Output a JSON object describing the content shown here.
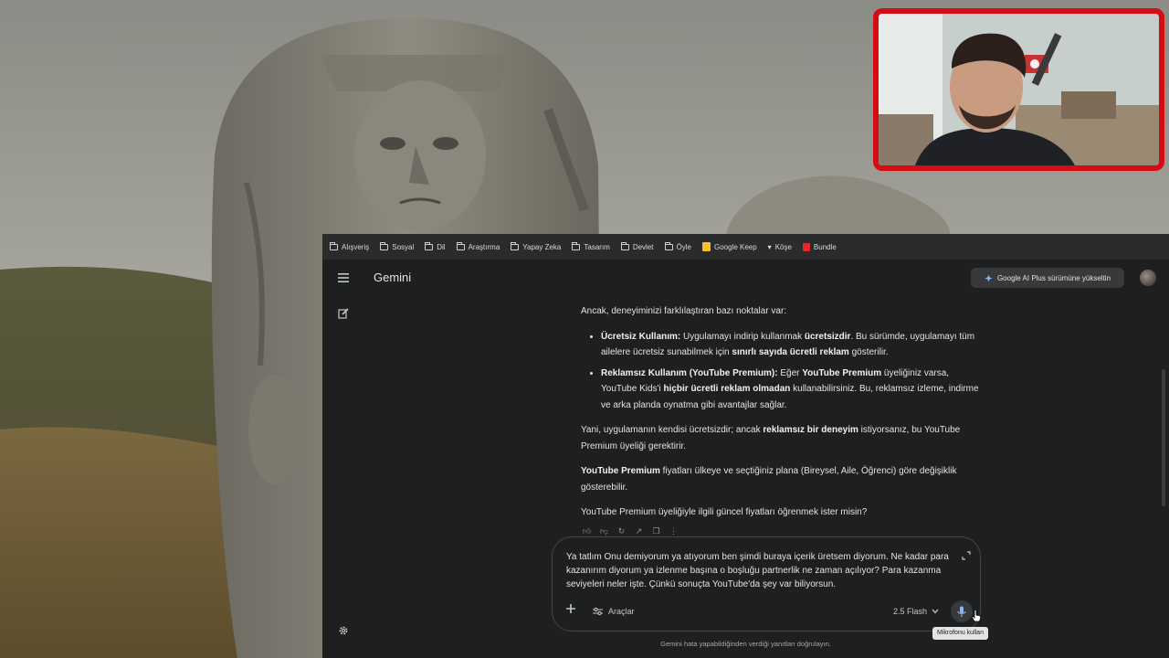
{
  "bookmarks": [
    {
      "label": "Alışveriş",
      "icon": "folder-icon"
    },
    {
      "label": "Sosyal",
      "icon": "folder-icon"
    },
    {
      "label": "Dil",
      "icon": "folder-icon"
    },
    {
      "label": "Araştırma",
      "icon": "folder-icon"
    },
    {
      "label": "Yapay Zeka",
      "icon": "folder-icon"
    },
    {
      "label": "Tasarım",
      "icon": "folder-icon"
    },
    {
      "label": "Devlet",
      "icon": "folder-icon"
    },
    {
      "label": "Öyle",
      "icon": "folder-icon"
    },
    {
      "label": "Google Keep",
      "icon": "keep-icon"
    },
    {
      "label": "Köşe",
      "icon": "kose-icon"
    },
    {
      "label": "Bundle",
      "icon": "bundle-icon"
    }
  ],
  "header": {
    "app_title": "Gemini",
    "upgrade_label": "Google AI Plus sürümüne yükseltin"
  },
  "chat": {
    "intro": "Ancak, deneyiminizi farklılaştıran bazı noktalar var:",
    "b1_title": "Ücretsiz Kullanım:",
    "b1_t1": " Uygulamayı indirip kullanmak ",
    "b1_bold1": "ücretsizdir",
    "b1_t2": ". Bu sürümde, uygulamayı tüm ailelere ücretsiz sunabilmek için ",
    "b1_bold2": "sınırlı sayıda ücretli reklam",
    "b1_t3": " gösterilir.",
    "b2_title": "Reklamsız Kullanım (YouTube Premium):",
    "b2_t1": " Eğer ",
    "b2_bold1": "YouTube Premium",
    "b2_t2": " üyeliğiniz varsa, YouTube Kids'i ",
    "b2_bold2": "hiçbir ücretli reklam olmadan",
    "b2_t3": " kullanabilirsiniz. Bu, reklamsız izleme, indirme ve arka planda oynatma gibi avantajlar sağlar.",
    "p2_t1": "Yani, uygulamanın kendisi ücretsizdir; ancak ",
    "p2_bold": "reklamsız bir deneyim",
    "p2_t2": " istiyorsanız, bu YouTube Premium üyeliği gerektirir.",
    "p3_bold": "YouTube Premium",
    "p3_t1": " fiyatları ülkeye ve seçtiğiniz plana (Bireysel, Aile, Öğrenci) göre değişiklik gösterebilir.",
    "p4": "YouTube Premium üyeliğiyle ilgili güncel fiyatları öğrenmek ister misin?"
  },
  "composer": {
    "prompt_text": "Ya tatlım Onu demiyorum ya atıyorum ben şimdi buraya içerik üretsem diyorum. Ne kadar para kazanırım diyorum ya izlenme başına o boşluğu partnerlik ne zaman açılıyor? Para kazanma seviyeleri neler işte. Çünkü sonuçta YouTube'da şey var biliyorsun.",
    "tools_label": "Araçlar",
    "model_label": "2.5 Flash",
    "mic_tooltip": "Mikrofonu kullan"
  },
  "footer": {
    "disclaimer": "Gemini hata yapabildiğinden verdiği yanıtları doğrulayın."
  },
  "colors": {
    "app_background": "#1e1f20",
    "bookmark_bar": "#2a2b2d",
    "webcam_border": "#d40c14",
    "mic_active": "#8ab4f8"
  }
}
